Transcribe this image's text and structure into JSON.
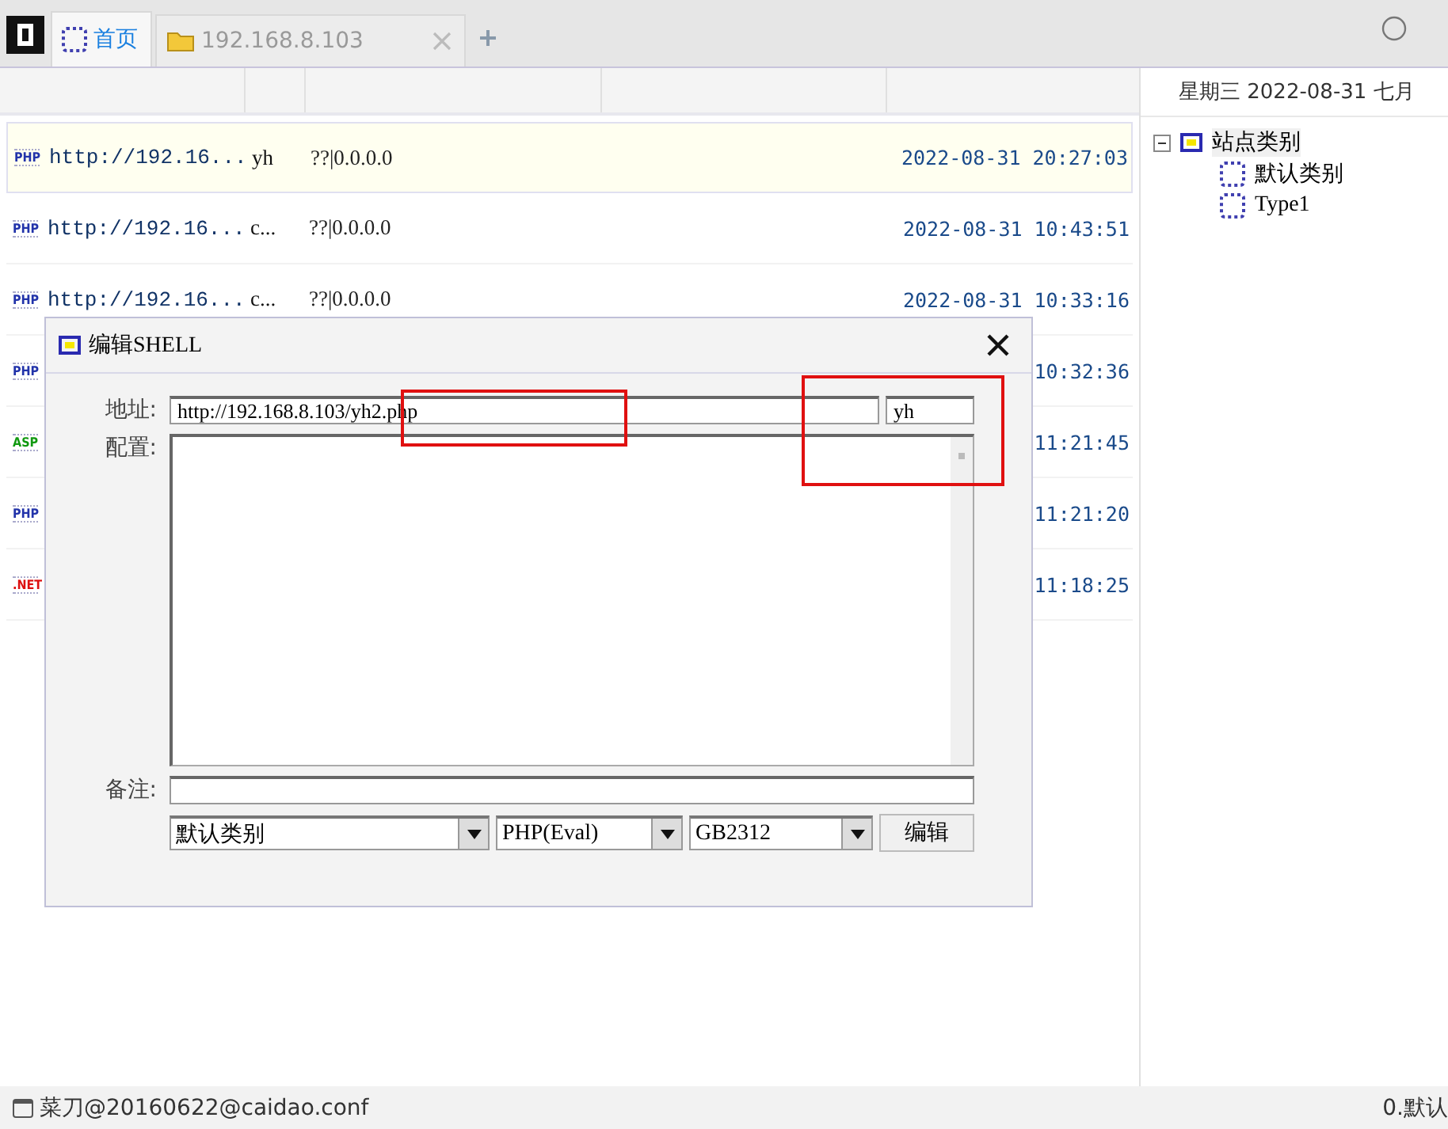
{
  "tabs": [
    {
      "label": "首页",
      "kind": "home",
      "selected": true
    },
    {
      "label": "192.168.8.103",
      "kind": "folder",
      "selected": false
    }
  ],
  "rows": [
    {
      "type": "PHP",
      "url": "http://192.16...",
      "name": "yh",
      "ip": "??|0.0.0.0",
      "config": "",
      "time": "2022-08-31 20:27:03",
      "selected": true
    },
    {
      "type": "PHP",
      "url": "http://192.16...",
      "name": "c...",
      "ip": "??|0.0.0.0",
      "config": "",
      "time": "2022-08-31 10:43:51",
      "selected": false
    },
    {
      "type": "PHP",
      "url": "http://192.16...",
      "name": "c...",
      "ip": "??|0.0.0.0",
      "config": "",
      "time": "2022-08-31 10:33:16",
      "selected": false
    },
    {
      "type": "PHP",
      "time": "10:32:36",
      "selected": false
    },
    {
      "type": "ASP",
      "time": "11:21:45",
      "selected": false
    },
    {
      "type": "PHP",
      "time": "11:21:20",
      "selected": false
    },
    {
      "type": ".NET",
      "time": "11:18:25",
      "selected": false
    }
  ],
  "side_header": "星期三  2022-08-31  七月",
  "tree": {
    "label": "站点类别",
    "selected": true,
    "expanded": true,
    "children": [
      {
        "label": "默认类别",
        "selected": false
      },
      {
        "label": "Type1",
        "selected": false
      }
    ]
  },
  "dialog": {
    "title": "编辑SHELL",
    "address_label": "地址:",
    "address": "http://192.168.8.103/yh2.php",
    "password": "yh",
    "config_label": "配置:",
    "note_label": "备注:",
    "category": "默认类别",
    "script_type": "PHP(Eval)",
    "encoding": "GB2312",
    "button": "编辑"
  },
  "status_bar": {
    "file": "菜刀@20160622@caidao.conf",
    "right": "0.默认"
  }
}
